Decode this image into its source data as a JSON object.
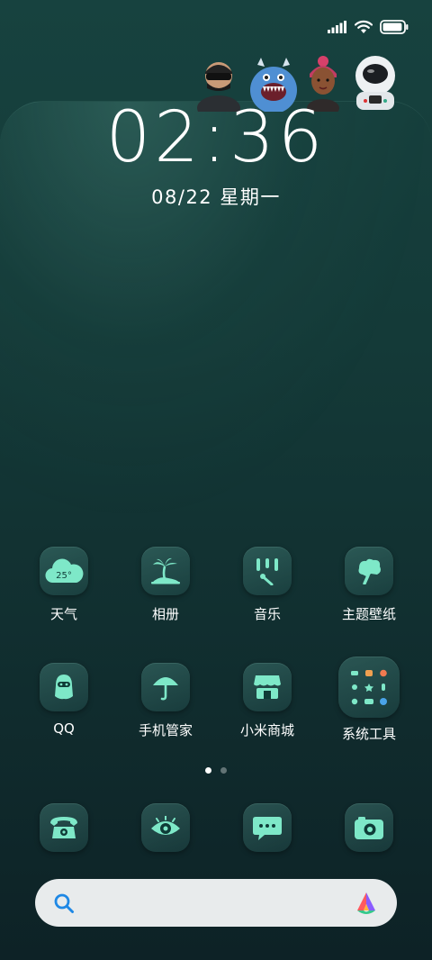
{
  "status": {
    "signal_icon": "signal-bars-icon",
    "wifi_icon": "wifi-icon",
    "battery_icon": "battery-icon",
    "battery_level": 0.95
  },
  "lockscreen": {
    "time": "02:36",
    "date": "08/22 星期一"
  },
  "avatars": [
    "masked-avatar",
    "blue-monster-avatar",
    "girl-avatar",
    "astronaut-avatar"
  ],
  "apps_row1": [
    {
      "label": "天气",
      "icon": "weather-cloud-icon",
      "temp": "25°"
    },
    {
      "label": "相册",
      "icon": "palm-island-icon"
    },
    {
      "label": "音乐",
      "icon": "music-bars-icon"
    },
    {
      "label": "主题壁纸",
      "icon": "theme-brush-icon"
    }
  ],
  "apps_row2": [
    {
      "label": "QQ",
      "icon": "qq-penguin-icon"
    },
    {
      "label": "手机管家",
      "icon": "umbrella-icon"
    },
    {
      "label": "小米商城",
      "icon": "store-icon"
    },
    {
      "label": "系统工具",
      "icon": "folder-grid-icon"
    }
  ],
  "dock": [
    {
      "icon": "phone-icon"
    },
    {
      "icon": "eye-browser-icon"
    },
    {
      "icon": "message-bubble-icon"
    },
    {
      "icon": "camera-icon"
    }
  ],
  "pages": {
    "count": 2,
    "active": 1
  },
  "colors": {
    "accent": "#7ee8c8",
    "accent_dark": "#2b6b63",
    "search_bg": "#e8ebec",
    "search_icon": "#1e88e5"
  }
}
